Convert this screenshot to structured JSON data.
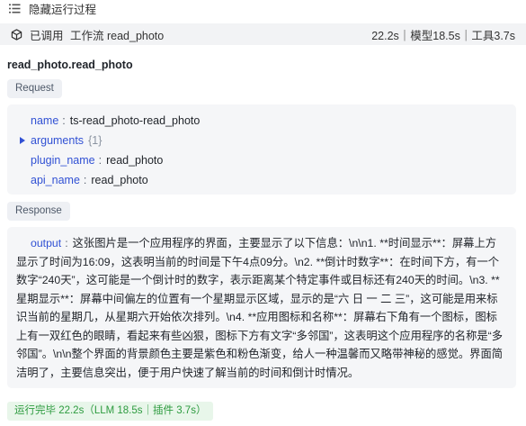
{
  "header": {
    "toggle_label": "隐藏运行过程"
  },
  "call": {
    "label": "已调用",
    "workflow_label": "工作流 read_photo",
    "timing": "22.2s｜模型18.5s｜工具3.7s"
  },
  "section_title": "read_photo.read_photo",
  "request": {
    "tag": "Request",
    "fields": [
      {
        "key": "name",
        "value": "ts-read_photo-read_photo"
      },
      {
        "key": "arguments",
        "count": "{1}"
      },
      {
        "key": "plugin_name",
        "value": "read_photo"
      },
      {
        "key": "api_name",
        "value": "read_photo"
      }
    ]
  },
  "response": {
    "tag": "Response",
    "key": "output",
    "value": "这张图片是一个应用程序的界面，主要显示了以下信息：\\n\\n1. **时间显示**：屏幕上方显示了时间为16:09，这表明当前的时间是下午4点09分。\\n2. **倒计时数字**：在时间下方，有一个数字“240天”，这可能是一个倒计时的数字，表示距离某个特定事件或目标还有240天的时间。\\n3. **星期显示**：屏幕中间偏左的位置有一个星期显示区域，显示的是“六 日 一 二 三”，这可能是用来标识当前的星期几，从星期六开始依次排列。\\n4. **应用图标和名称**：屏幕右下角有一个图标，图标上有一双红色的眼睛，看起来有些凶狠，图标下方有文字“多邻国”，这表明这个应用程序的名称是“多邻国”。\\n\\n整个界面的背景颜色主要是紫色和粉色渐变，给人一种温馨而又略带神秘的感觉。界面简洁明了，主要信息突出，便于用户快速了解当前的时间和倒计时情况。"
  },
  "status": {
    "text": "运行完毕 22.2s（LLM 18.5s｜插件 3.7s）"
  },
  "colors": {
    "key": "#3151d4",
    "status_text": "#2d9b3f",
    "status_bg": "#e8f6ea"
  },
  "icons": {
    "toggle": "list-icon",
    "workflow": "cube-icon",
    "expand": "triangle-right-icon"
  }
}
